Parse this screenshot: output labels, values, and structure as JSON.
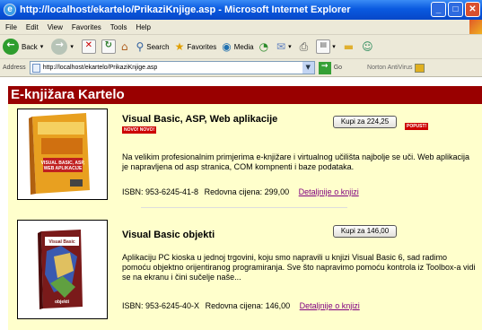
{
  "window": {
    "title": "http://localhost/ekartelo/PrikaziKnjige.asp - Microsoft Internet Explorer",
    "minimize": "_",
    "maximize": "□",
    "close": "✕"
  },
  "menu": [
    "File",
    "Edit",
    "View",
    "Favorites",
    "Tools",
    "Help"
  ],
  "toolbar": {
    "back": "Back",
    "search": "Search",
    "favorites": "Favorites",
    "media": "Media"
  },
  "address": {
    "label": "Address",
    "url": "http://localhost/ekartelo/PrikaziKnjige.asp",
    "go": "Go",
    "norton": "Norton AntiVirus"
  },
  "page": {
    "banner": "E-knjižara Kartelo",
    "books": [
      {
        "title": "Visual Basic, ASP, Web aplikacije",
        "buy": "Kupi za 224,25",
        "badge_new": "NOVO! NOVO!",
        "badge_discount": "POPUST!",
        "description": "Na velikim profesionalnim primjerima e-knjižare i virtualnog učilišta najbolje se uči. Web aplikacija je napravljena od asp stranica, COM kompnenti i baze podataka.",
        "isbn": "ISBN: 953-6245-41-8",
        "price": "Redovna cijena: 299,00",
        "details": "Detaljnije o knjizi",
        "cover_text": [
          "VISUAL BASIC, ASP,",
          "WEB APLIKACIJE"
        ]
      },
      {
        "title": "Visual Basic objekti",
        "buy": "Kupi za 146,00",
        "description": "Aplikaciju PC kioska u jednoj trgovini, koju smo napravili u knjizi Visual Basic 6, sad radimo pomoću objektno orijentiranog programiranja. Sve što napravimo pomoću kontrola iz Toolbox-a vidi se na ekranu i čini sučelje naše...",
        "isbn": "ISBN: 953-6245-40-X",
        "price": "Redovna cijena: 146,00",
        "details": "Detaljnije o knjizi",
        "cover_text": [
          "Visual Basic",
          "objekti"
        ]
      }
    ]
  },
  "colors": {
    "banner": "#990000",
    "page_bg": "#ffffcc",
    "link": "#800080",
    "badge": "#cc0000"
  }
}
